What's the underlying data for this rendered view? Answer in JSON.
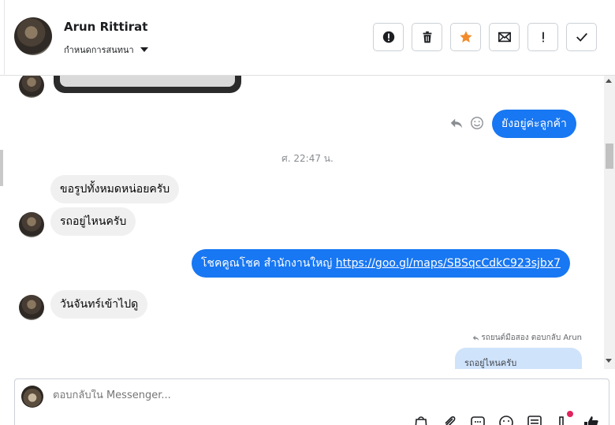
{
  "header": {
    "contact_name": "Arun Rittirat",
    "contact_subtitle": "กำหนดการสนทนา",
    "actions": [
      {
        "icon": "alert-circle-icon",
        "name": "spam-button"
      },
      {
        "icon": "trash-icon",
        "name": "delete-button"
      },
      {
        "icon": "star-icon",
        "name": "star-button",
        "color": "#f28b2b"
      },
      {
        "icon": "envelope-icon",
        "name": "mark-unread-button"
      },
      {
        "icon": "exclamation-icon",
        "name": "follow-up-button"
      },
      {
        "icon": "check-icon",
        "name": "done-button"
      }
    ]
  },
  "conversation": {
    "outgoing_1": "ยังอยู่ค่ะลูกค้า",
    "timestamp": "ศ. 22:47 น.",
    "incoming_1": "ขอรูปทั้งหมดหน่อยครับ",
    "incoming_2": "รถอยู่ไหนครับ",
    "outgoing_2_text": "โชคคูณโชค สำนักงานใหญ่ ",
    "outgoing_2_link": "https://goo.gl/maps/SBSqcCdkC923sjbx7",
    "incoming_3": "วันจันทร์เข้าไปดู",
    "reply_meta": "รถยนต์มือสอง ตอบกลับ Arun",
    "reply_quote": "รถอยู่ไหนครับ"
  },
  "composer": {
    "placeholder": "ตอบกลับใน Messenger...",
    "tools": [
      "bag-icon",
      "paperclip-icon",
      "saved-replies-icon",
      "emoji-icon",
      "template-icon",
      "appointment-icon",
      "like-icon"
    ]
  },
  "colors": {
    "outgoing_bubble": "#1877f2",
    "incoming_bubble": "#f0f0f0",
    "reply_quote_bg": "#cfe3fb",
    "accent_star": "#f28b2b"
  }
}
